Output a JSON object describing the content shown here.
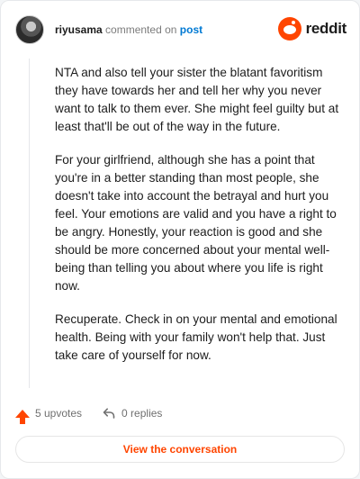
{
  "header": {
    "username": "riyusama",
    "action_text": "commented on",
    "post_link": "post",
    "brand_name": "reddit",
    "brand_color": "#ff4500",
    "link_color": "#0079d3"
  },
  "comment": {
    "paragraphs": [
      "NTA and also tell your sister the blatant favoritism they have towards her and tell her why you never want to talk to them ever. She might feel guilty but at least that'll be out of the way in the future.",
      "For your girlfriend, although she has a point that you're in a better standing than most people, she doesn't take into account the betrayal and hurt you feel. Your emotions are valid and you have a right to be angry. Honestly, your reaction is good and she should be more concerned about your mental well-being than telling you about where you life is right now.",
      "Recuperate. Check in on your mental and emotional health. Being with your family won't help that. Just take care of yourself for now."
    ]
  },
  "actions": {
    "upvotes_label": "5 upvotes",
    "replies_label": "0 replies",
    "upvote_icon": "arrow-up-icon",
    "reply_icon": "reply-arrow-icon"
  },
  "footer": {
    "view_button_label": "View the conversation"
  }
}
